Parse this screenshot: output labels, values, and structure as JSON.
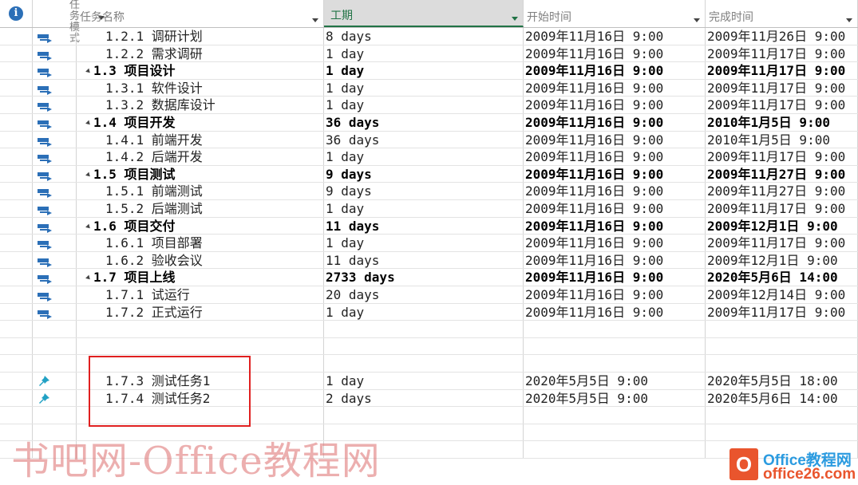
{
  "header": {
    "mode_label_1": "任务",
    "mode_label_2": "模式",
    "name_label": "任务名称",
    "duration_label": "工期",
    "start_label": "开始时间",
    "finish_label": "完成时间"
  },
  "icons": {
    "info": "info-icon",
    "auto_task": "auto-schedule-icon",
    "manual_task": "manual-schedule-pin-icon"
  },
  "colors": {
    "accent": "#217346",
    "icon_blue": "#2b6fb7",
    "pin": "#21a1c4",
    "highlight_box": "#e02020"
  },
  "tasks": [
    {
      "name": "1.2.1 调研计划",
      "duration": "8 days",
      "start": "2009年11月16日 9:00",
      "finish": "2009年11月26日 9:00"
    },
    {
      "name": "1.2.2 需求调研",
      "duration": "1 day",
      "start": "2009年11月16日 9:00",
      "finish": "2009年11月17日 9:00"
    },
    {
      "name": "1.3 项目设计",
      "duration": "1 day",
      "start": "2009年11月16日 9:00",
      "finish": "2009年11月17日 9:00"
    },
    {
      "name": "1.3.1 软件设计",
      "duration": "1 day",
      "start": "2009年11月16日 9:00",
      "finish": "2009年11月17日 9:00"
    },
    {
      "name": "1.3.2 数据库设计",
      "duration": "1 day",
      "start": "2009年11月16日 9:00",
      "finish": "2009年11月17日 9:00"
    },
    {
      "name": "1.4 项目开发",
      "duration": "36 days",
      "start": "2009年11月16日 9:00",
      "finish": "2010年1月5日 9:00"
    },
    {
      "name": "1.4.1 前端开发",
      "duration": "36 days",
      "start": "2009年11月16日 9:00",
      "finish": "2010年1月5日 9:00"
    },
    {
      "name": "1.4.2 后端开发",
      "duration": "1 day",
      "start": "2009年11月16日 9:00",
      "finish": "2009年11月17日 9:00"
    },
    {
      "name": "1.5 项目测试",
      "duration": "9 days",
      "start": "2009年11月16日 9:00",
      "finish": "2009年11月27日 9:00"
    },
    {
      "name": "1.5.1 前端测试",
      "duration": "9 days",
      "start": "2009年11月16日 9:00",
      "finish": "2009年11月27日 9:00"
    },
    {
      "name": "1.5.2 后端测试",
      "duration": "1 day",
      "start": "2009年11月16日 9:00",
      "finish": "2009年11月17日 9:00"
    },
    {
      "name": "1.6 项目交付",
      "duration": "11 days",
      "start": "2009年11月16日 9:00",
      "finish": "2009年12月1日 9:00"
    },
    {
      "name": "1.6.1 项目部署",
      "duration": "1 day",
      "start": "2009年11月16日 9:00",
      "finish": "2009年11月17日 9:00"
    },
    {
      "name": "1.6.2 验收会议",
      "duration": "11 days",
      "start": "2009年11月16日 9:00",
      "finish": "2009年12月1日 9:00"
    },
    {
      "name": "1.7 项目上线",
      "duration": "2733 days",
      "start": "2009年11月16日 9:00",
      "finish": "2020年5月6日 14:00"
    },
    {
      "name": "1.7.1 试运行",
      "duration": "20 days",
      "start": "2009年11月16日 9:00",
      "finish": "2009年12月14日 9:00"
    },
    {
      "name": "1.7.2 正式运行",
      "duration": "1 day",
      "start": "2009年11月16日 9:00",
      "finish": "2009年11月17日 9:00"
    },
    {
      "name": "",
      "duration": "",
      "start": "",
      "finish": ""
    },
    {
      "name": "",
      "duration": "",
      "start": "",
      "finish": ""
    },
    {
      "name": "",
      "duration": "",
      "start": "",
      "finish": ""
    },
    {
      "name": "1.7.3 测试任务1",
      "duration": "1 day",
      "start": "2020年5月5日 9:00",
      "finish": "2020年5月5日 18:00"
    },
    {
      "name": "1.7.4 测试任务2",
      "duration": "2 days",
      "start": "2020年5月5日 9:00",
      "finish": "2020年5月6日 14:00"
    },
    {
      "name": "",
      "duration": "",
      "start": "",
      "finish": ""
    },
    {
      "name": "",
      "duration": "",
      "start": "",
      "finish": ""
    },
    {
      "name": "",
      "duration": "",
      "start": "",
      "finish": ""
    }
  ],
  "watermark": "书吧网-Office教程网",
  "logo": {
    "mark": "O",
    "line1": "Office教程网",
    "line2": "office26.com"
  }
}
